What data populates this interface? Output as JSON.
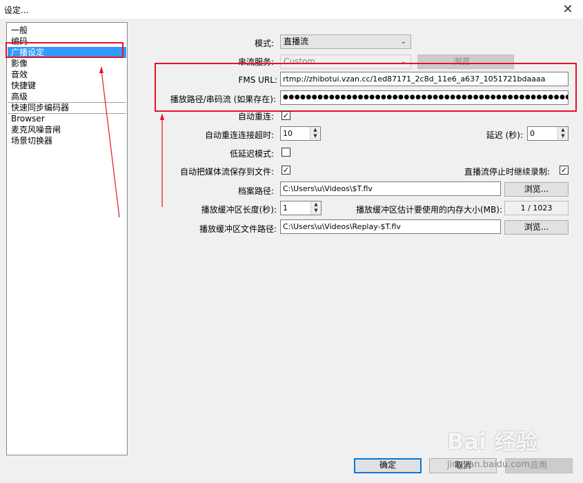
{
  "window": {
    "title": "设定...",
    "close": "✕"
  },
  "categories": [
    "一般",
    "编码",
    "广播设定",
    "影像",
    "音效",
    "快捷键",
    "高级",
    "快速同步编码器",
    "Browser",
    "麦克风噪音闸",
    "场景切换器"
  ],
  "selected_category": "广播设定",
  "form": {
    "mode_label": "模式:",
    "mode_value": "直播流",
    "service_label": "串流服务:",
    "service_value": "Custom",
    "browse_label": "浏览...",
    "fms_url_label": "FMS URL:",
    "fms_url_value": "rtmp://zhibotui.vzan.cc/1ed87171_2c8d_11e6_a637_1051721bdaaaa",
    "play_path_label": "播放路径/串码流 (如果存在):",
    "play_path_value": "●●●●●●●●●●●●●●●●●●●●●●●●●●●●●●●●●●●●●●●●●●●●●●●●●●●●●●●●●●●●●",
    "auto_reconnect_label": "自动重连:",
    "auto_reconnect_checked": "✓",
    "reconnect_timeout_label": "自动重连连接超时:",
    "reconnect_timeout_value": "10",
    "delay_label": "延迟 (秒):",
    "delay_value": "0",
    "low_latency_label": "低延迟模式:",
    "low_latency_checked": "",
    "save_to_file_label": "自动把媒体流保存到文件:",
    "save_to_file_checked": "✓",
    "keep_recording_label": "直播流停止时继续录制:",
    "keep_recording_checked": "✓",
    "file_path_label": "档案路径:",
    "file_path_value": "C:\\Users\\u\\Videos\\$T.flv",
    "replay_length_label": "播放缓冲区长度(秒):",
    "replay_length_value": "1",
    "replay_memory_label": "播放缓冲区估计要使用的内存大小(MB):",
    "replay_memory_value": "1 / 1023",
    "replay_path_label": "播放缓冲区文件路径:",
    "replay_path_value": "C:\\Users\\u\\Videos\\Replay-$T.flv"
  },
  "footer": {
    "ok": "确定",
    "cancel": "取消",
    "apply": "应用"
  },
  "watermark": {
    "logo": "Bai 经验",
    "url": "jingyan.baidu.com"
  },
  "colors": {
    "selection": "#3399ff",
    "annotation": "#e81123"
  }
}
